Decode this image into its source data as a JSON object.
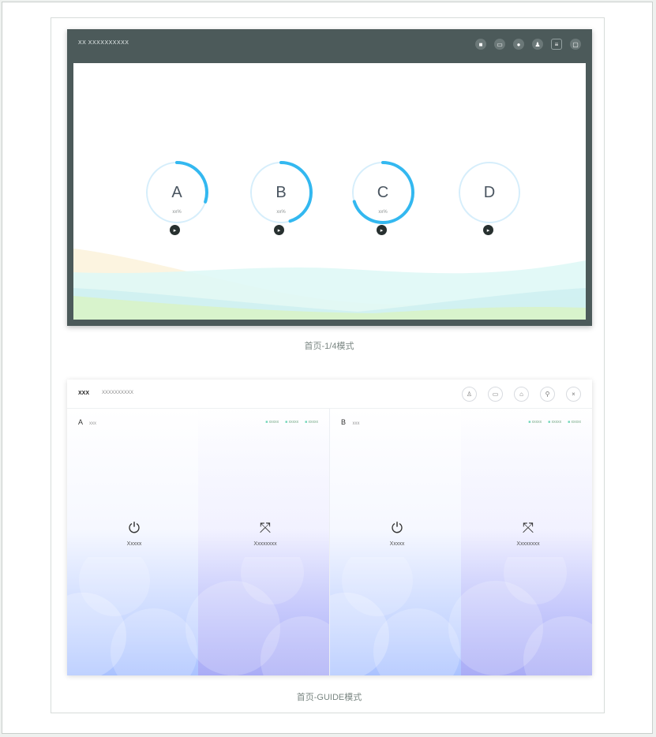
{
  "panel1": {
    "title": "XX XXXXXXXXXX",
    "toolbar_icons": [
      "stop-icon",
      "monitor-icon",
      "record-icon",
      "user-icon",
      "settings-icon",
      "lock-icon"
    ],
    "gauges": [
      {
        "letter": "A",
        "percent": "xx%",
        "progress": 0.3
      },
      {
        "letter": "B",
        "percent": "xx%",
        "progress": 0.45
      },
      {
        "letter": "C",
        "percent": "xx%",
        "progress": 0.7
      },
      {
        "letter": "D",
        "percent": "",
        "progress": 0.0
      }
    ],
    "caption": "首页-1/4模式",
    "colors": {
      "frame": "#4c5a5a",
      "gauge_arc": "#33b8f0",
      "gauge_ring": "#d6eefb"
    }
  },
  "panel2": {
    "logo": "XXX",
    "subtitle": "XXXXXXXXXX",
    "toolbar_icons": [
      "user-icon",
      "monitor-icon",
      "lock-icon",
      "person-icon",
      "close-icon"
    ],
    "columns": [
      {
        "name": "A",
        "label": "xxx",
        "legend": [
          "xxxxx",
          "xxxxx",
          "xxxxx"
        ],
        "modes": [
          {
            "icon": "power-icon",
            "label": "Xxxxx"
          },
          {
            "icon": "shuffle-icon",
            "label": "Xxxxxxxx"
          }
        ]
      },
      {
        "name": "B",
        "label": "xxx",
        "legend": [
          "xxxxx",
          "xxxxx",
          "xxxxx"
        ],
        "modes": [
          {
            "icon": "power-icon",
            "label": "Xxxxx"
          },
          {
            "icon": "shuffle-icon",
            "label": "Xxxxxxxx"
          }
        ]
      }
    ],
    "caption": "首页-GUIDE模式"
  }
}
